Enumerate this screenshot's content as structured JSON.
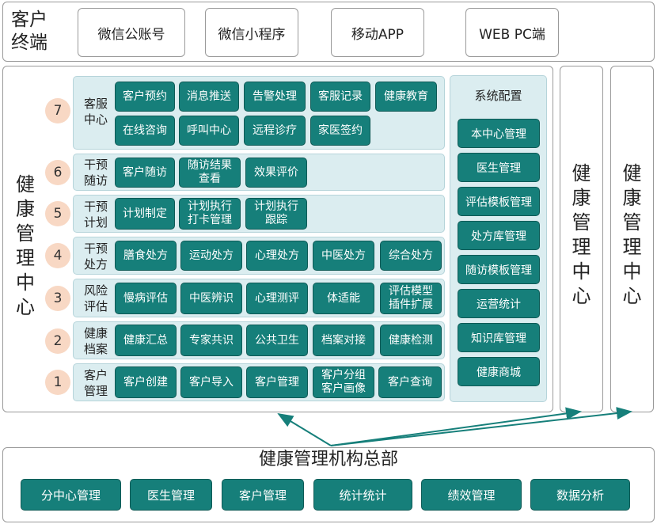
{
  "client": {
    "label_line1": "客户",
    "label_line2": "终端",
    "channels": [
      "微信公账号",
      "微信小程序",
      "移动APP",
      "WEB PC端"
    ]
  },
  "center": {
    "title_chars": [
      "健",
      "康",
      "管",
      "理",
      "中",
      "心"
    ],
    "rows": [
      {
        "number": "7",
        "label": [
          "客服",
          "中心"
        ],
        "buttons": [
          "客户预约",
          "消息推送",
          "告警处理",
          "客服记录",
          "健康教育",
          "在线咨询",
          "呼叫中心",
          "远程诊疗",
          "家医签约"
        ]
      },
      {
        "number": "6",
        "label": [
          "干预",
          "随访"
        ],
        "buttons": [
          "客户随访",
          "随访结果\n查看",
          "效果评价"
        ]
      },
      {
        "number": "5",
        "label": [
          "干预",
          "计划"
        ],
        "buttons": [
          "计划制定",
          "计划执行\n打卡管理",
          "计划执行\n跟踪"
        ]
      },
      {
        "number": "4",
        "label": [
          "干预",
          "处方"
        ],
        "buttons": [
          "膳食处方",
          "运动处方",
          "心理处方",
          "中医处方",
          "综合处方"
        ]
      },
      {
        "number": "3",
        "label": [
          "风险",
          "评估"
        ],
        "buttons": [
          "慢病评估",
          "中医辨识",
          "心理测评",
          "体适能",
          "评估模型\n插件扩展"
        ]
      },
      {
        "number": "2",
        "label": [
          "健康",
          "档案"
        ],
        "buttons": [
          "健康汇总",
          "专家共识",
          "公共卫生",
          "档案对接",
          "健康检测"
        ]
      },
      {
        "number": "1",
        "label": [
          "客户",
          "管理"
        ],
        "buttons": [
          "客户创建",
          "客户导入",
          "客户管理",
          "客户分组\n客户画像",
          "客户查询"
        ]
      }
    ],
    "config": {
      "title": "系统配置",
      "items": [
        "本中心管理",
        "医生管理",
        "评估模板管理",
        "处方库管理",
        "随访模板管理",
        "运营统计",
        "知识库管理",
        "健康商城"
      ]
    }
  },
  "side_centers": [
    {
      "chars": [
        "健",
        "康",
        "管",
        "理",
        "中",
        "心"
      ]
    },
    {
      "chars": [
        "健",
        "康",
        "管",
        "理",
        "中",
        "心"
      ]
    }
  ],
  "hq": {
    "title": "健康管理机构总部",
    "buttons": [
      "分中心管理",
      "医生管理",
      "客户管理",
      "统计统计",
      "绩效管理",
      "数据分析"
    ]
  },
  "colors": {
    "button": "#167f7a",
    "row_bg": "#dbedf0",
    "badge": "#f8d8c4",
    "arrow": "#167f7a"
  }
}
